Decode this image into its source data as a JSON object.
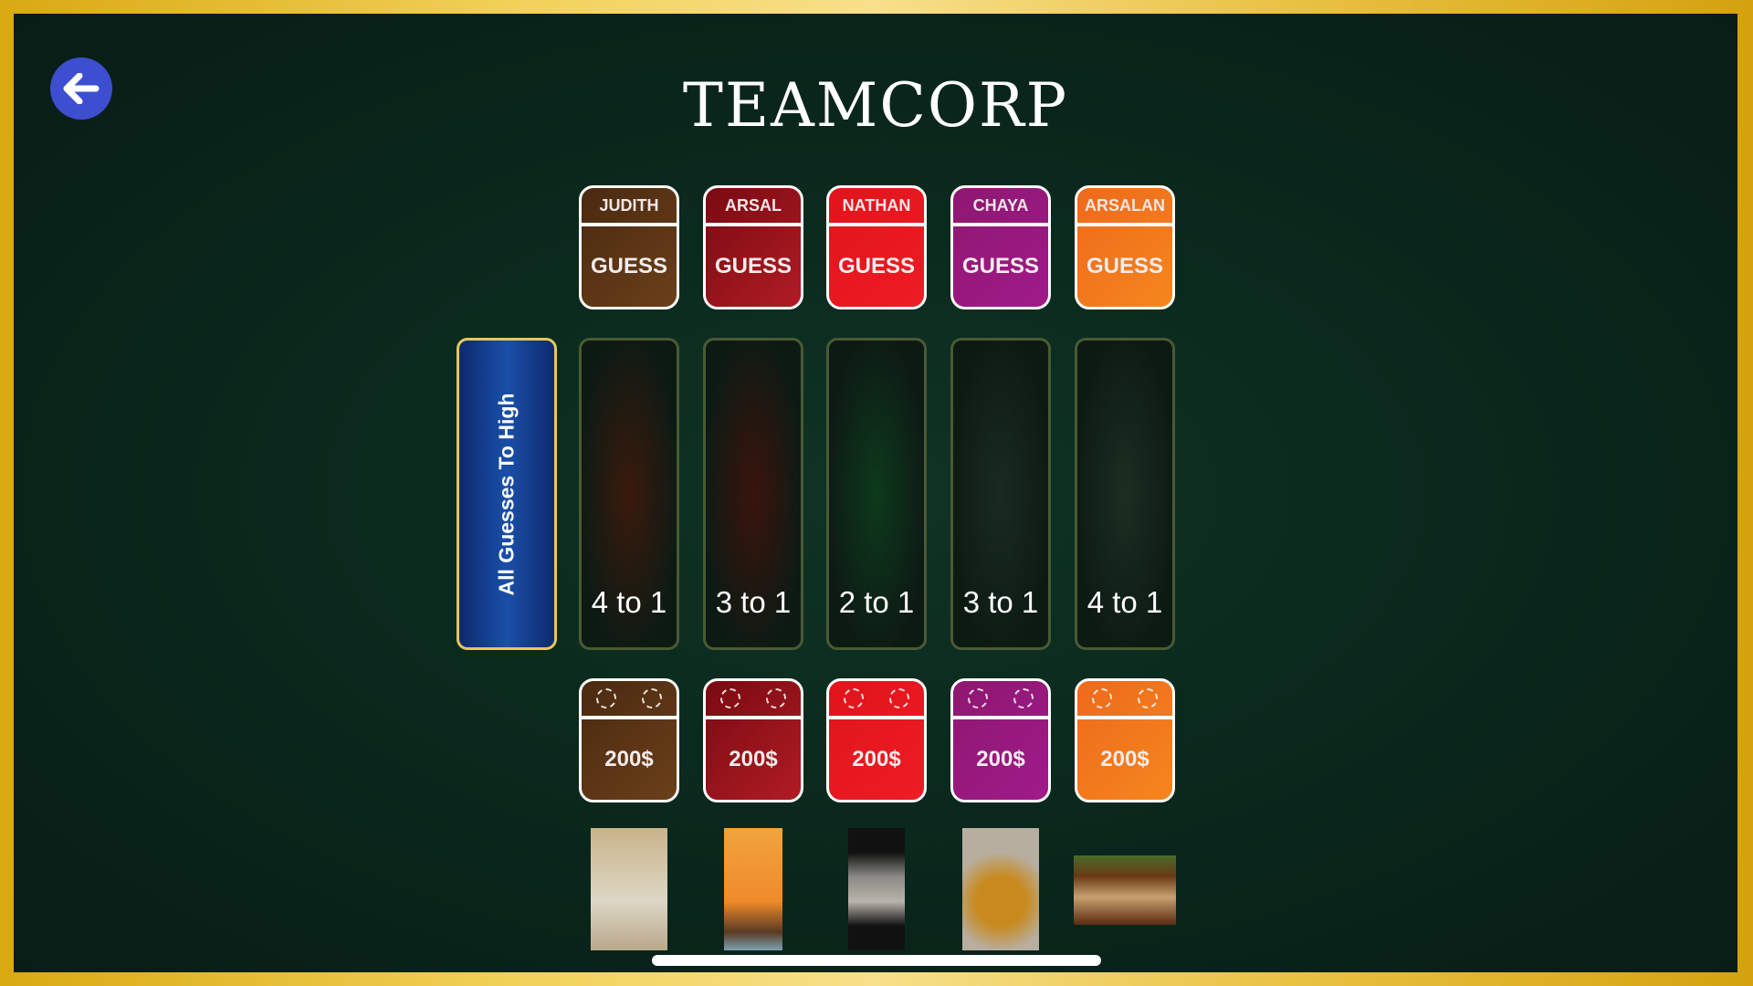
{
  "header": {
    "title": "TEAMCORP",
    "back_icon": "arrow-left-icon"
  },
  "all_guesses_label": "All Guesses To High",
  "players": [
    {
      "name": "JUDITH",
      "guess_label": "GUESS",
      "odds": "4 to 1",
      "bet": "200$",
      "color": "#6b3f1a",
      "color2": "#4a2a10",
      "col_glow": "#3a1a0c"
    },
    {
      "name": "ARSAL",
      "guess_label": "GUESS",
      "odds": "3 to 1",
      "bet": "200$",
      "color": "#b01c24",
      "color2": "#7a0a12",
      "col_glow": "#3a140c"
    },
    {
      "name": "NATHAN",
      "guess_label": "GUESS",
      "odds": "2 to 1",
      "bet": "200$",
      "color": "#ee1c24",
      "color2": "#e0141c",
      "col_glow": "#0d3a1c"
    },
    {
      "name": "CHAYA",
      "guess_label": "GUESS",
      "odds": "3 to 1",
      "bet": "200$",
      "color": "#a01a8a",
      "color2": "#8e1870",
      "col_glow": "#1a2a22"
    },
    {
      "name": "ARSALAN",
      "guess_label": "GUESS",
      "odds": "4 to 1",
      "bet": "200$",
      "color": "#f5861e",
      "color2": "#ee6a1c",
      "col_glow": "#1c2e22"
    }
  ],
  "thumbnails": [
    "photo-child-hallway",
    "photo-sailing-ship-sunset",
    "screenshot-post-old-man",
    "photo-food-dish",
    "screenshot-game-ui"
  ]
}
